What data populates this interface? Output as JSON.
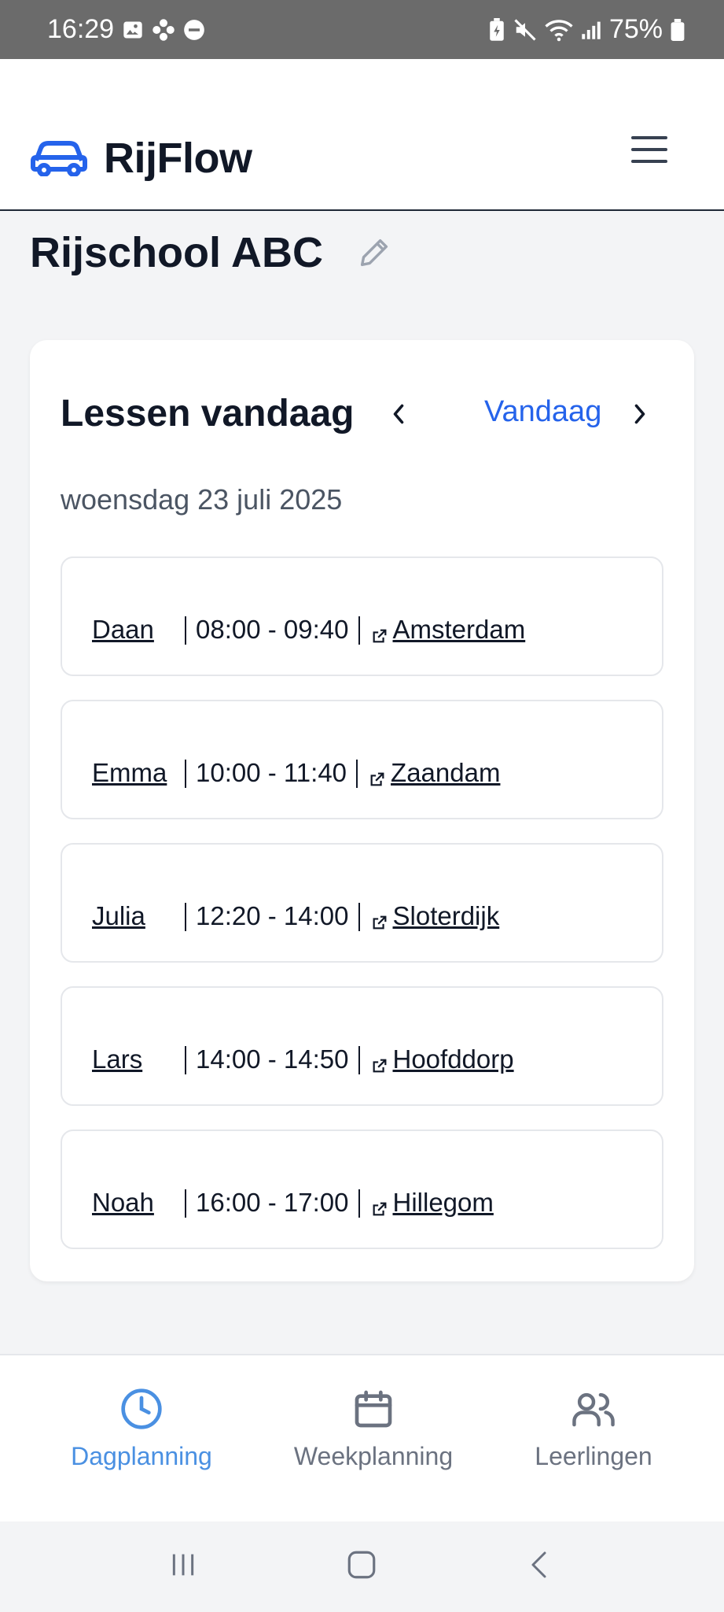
{
  "status_bar": {
    "time": "16:29",
    "battery": "75%",
    "left_icons": [
      "gallery-icon",
      "flower-icon",
      "do-not-disturb-icon"
    ],
    "right_icons": [
      "battery-saver-icon",
      "mute-icon",
      "wifi-icon",
      "signal-icon",
      "battery-icon"
    ]
  },
  "header": {
    "brand": "RijFlow",
    "logo_icon": "car-icon",
    "menu_icon": "hamburger-menu-icon",
    "brand_color": "#2563eb"
  },
  "page": {
    "title": "Rijschool ABC",
    "edit_icon": "pencil-icon"
  },
  "card": {
    "title": "Lessen vandaag",
    "today_label": "Vandaag",
    "date": "woensdag 23 juli 2025",
    "lessons": [
      {
        "name": "Daan",
        "time": "08:00 - 09:40",
        "location": "Amsterdam"
      },
      {
        "name": "Emma",
        "time": "10:00 - 11:40",
        "location": "Zaandam"
      },
      {
        "name": "Julia",
        "time": "12:20 - 14:00",
        "location": "Sloterdijk"
      },
      {
        "name": "Lars",
        "time": "14:00 - 14:50",
        "location": "Hoofddorp"
      },
      {
        "name": "Noah",
        "time": "16:00 - 17:00",
        "location": "Hillegom"
      }
    ]
  },
  "bottom_nav": {
    "items": [
      {
        "label": "Dagplanning",
        "icon": "clock-icon",
        "active": true
      },
      {
        "label": "Weekplanning",
        "icon": "calendar-icon",
        "active": false
      },
      {
        "label": "Leerlingen",
        "icon": "users-icon",
        "active": false
      }
    ],
    "active_color": "#4a90e2",
    "inactive_color": "#6b7280"
  }
}
